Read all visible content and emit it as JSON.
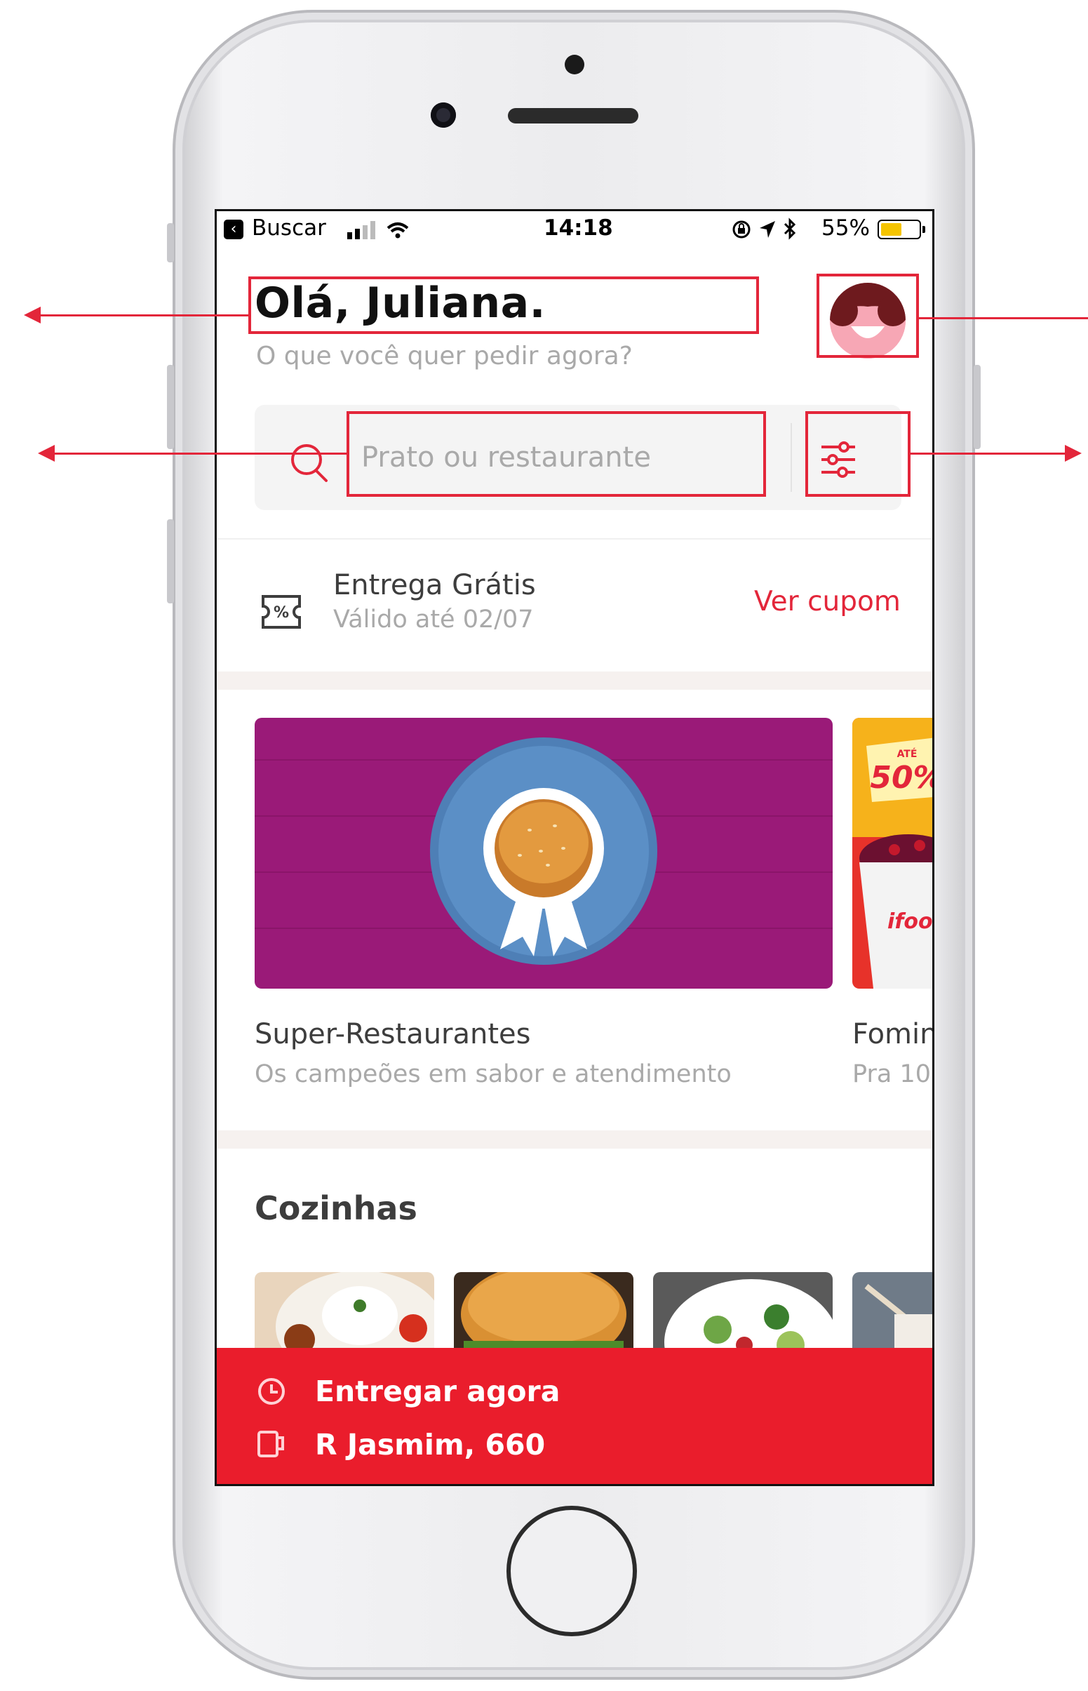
{
  "status_bar": {
    "back_label": "Buscar",
    "time": "14:18",
    "battery": "55%",
    "battery_level": 0.55
  },
  "header": {
    "greeting": "Olá, Juliana.",
    "subtitle": "O que você quer pedir agora?"
  },
  "search": {
    "placeholder": "Prato ou restaurante"
  },
  "coupon": {
    "title": "Entrega Grátis",
    "subtitle": "Válido até 02/07",
    "link": "Ver cupom"
  },
  "featured": [
    {
      "title": "Super-Restaurantes",
      "subtitle": "Os campeões em sabor e atendimento"
    },
    {
      "title": "Fomin",
      "subtitle": "Pra 10",
      "badge_top": "ATÉ",
      "badge": "50%",
      "brand": "ifoo"
    }
  ],
  "cuisines": {
    "title": "Cozinhas"
  },
  "bottom_bar": {
    "delivery_time": "Entregar agora",
    "address": "R Jasmim, 660"
  },
  "colors": {
    "brand_red": "#ea1d2c",
    "annotation": "#e3263a",
    "text_dark": "#3d3d3d",
    "text_muted": "#a9a9a9",
    "banner_purple": "#9a1a78",
    "plate_blue": "#5b8fc6"
  },
  "icons": [
    "back-arrow-icon",
    "signal-icon",
    "wifi-icon",
    "lock-rotation-icon",
    "location-icon",
    "bluetooth-icon",
    "battery-icon",
    "search-icon",
    "filter-sliders-icon",
    "coupon-percent-icon",
    "clock-icon",
    "cup-icon"
  ]
}
